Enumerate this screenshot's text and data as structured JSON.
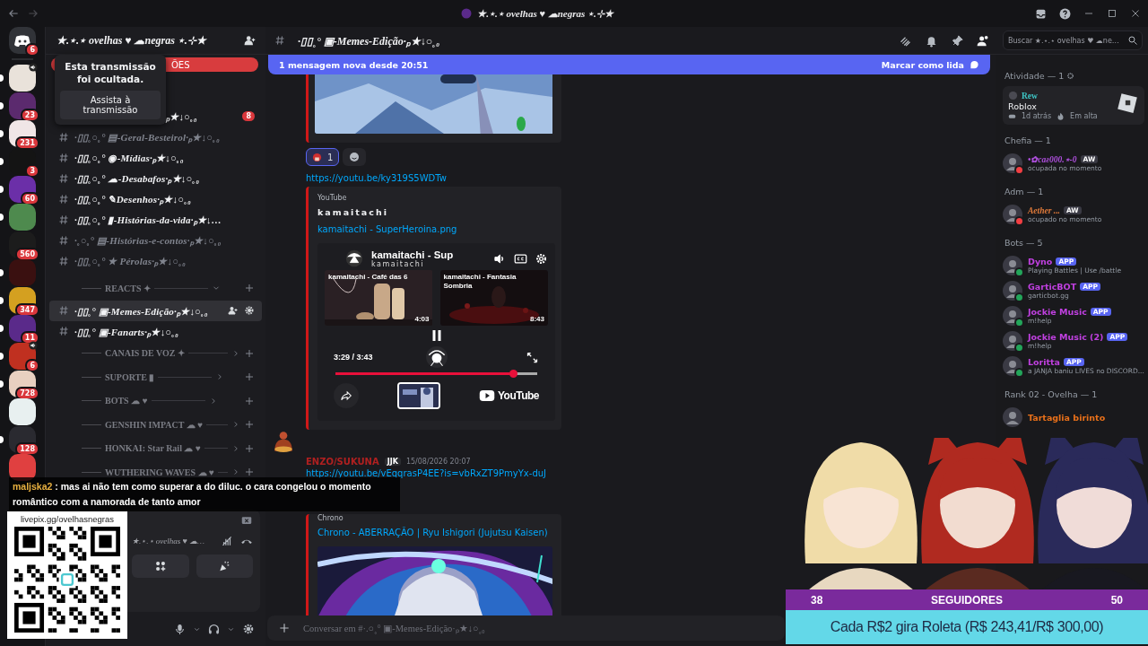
{
  "window": {
    "title": "★.⋆.⋆ ovelhas ♥ ☁negras ⋆.⊹★"
  },
  "servers": [
    {
      "badge": "6",
      "color": "#313338",
      "unread": false,
      "speaker": false,
      "kind": "home"
    },
    {
      "color": "#e9e2da",
      "unread": true,
      "speaker": true,
      "kind": "server"
    },
    {
      "badge": "23",
      "color": "#5b2a6e",
      "unread": true,
      "speaker": false,
      "kind": "server"
    },
    {
      "badge": "231",
      "color": "#f0e6e6",
      "unread": true,
      "speaker": false,
      "kind": "server"
    },
    {
      "badge": "3",
      "color": "#141414",
      "unread": true,
      "speaker": false,
      "kind": "server"
    },
    {
      "badge": "60",
      "color": "#6b2fa8",
      "unread": true,
      "speaker": false,
      "kind": "server"
    },
    {
      "color": "#4e8a4e",
      "unread": true,
      "speaker": false,
      "kind": "server"
    },
    {
      "badge": "560",
      "color": "#1c1c1c",
      "unread": false,
      "speaker": false,
      "kind": "server"
    },
    {
      "color": "#3a1010",
      "unread": true,
      "speaker": false,
      "kind": "server"
    },
    {
      "badge": "347",
      "color": "#d4a020",
      "unread": true,
      "speaker": false,
      "kind": "server"
    },
    {
      "badge": "11",
      "color": "#5a2a8a",
      "unread": true,
      "speaker": false,
      "kind": "server"
    },
    {
      "badge": "6",
      "color": "#c03020",
      "unread": true,
      "speaker": true,
      "kind": "server"
    },
    {
      "badge": "728",
      "color": "#e8d0c0",
      "unread": true,
      "speaker": false,
      "kind": "server"
    },
    {
      "color": "#e8f0f0",
      "unread": false,
      "speaker": false,
      "kind": "server"
    },
    {
      "badge": "128",
      "color": "#2a2a30",
      "unread": true,
      "speaker": false,
      "kind": "server"
    },
    {
      "color": "#e04040",
      "unread": false,
      "speaker": false,
      "kind": "server"
    }
  ],
  "sidebar": {
    "server_name": "★.⋆.⋆ ovelhas ♥ ☁negras ⋆.⊹★",
    "events_text": "ÕES",
    "tooltip": {
      "message": "Esta transmissão foi ocultada.",
      "button": "Assista à transmissão"
    },
    "partial_channel": {
      "text": "ₚ★↓○˳₀",
      "badge": "8"
    },
    "channels": [
      {
        "kind": "channel",
        "name": "·▯▯˳○˳° ▤-Geral-Besteirol·ₚ★↓○˳₀",
        "unread": false,
        "selected": false
      },
      {
        "kind": "channel",
        "name": "·▯▯˳○˳° ◉-Mídias·ₚ★↓○˳₀",
        "unread": true,
        "selected": false
      },
      {
        "kind": "channel",
        "name": "·▯▯˳○˳° ☁-Desabafos·ₚ★↓○˳₀",
        "unread": true,
        "selected": false
      },
      {
        "kind": "channel",
        "name": "·▯▯˳○˳° ✎Desenhos·ₚ★↓○˳₀",
        "unread": true,
        "selected": false
      },
      {
        "kind": "channel",
        "name": "·▯▯˳○˳° ▮-Histórias-da-vida·ₚ★↓…",
        "unread": true,
        "selected": false
      },
      {
        "kind": "channel",
        "name": "·˳○˳° ▤-Histórias-e-contos·ₚ★↓○˳₀",
        "unread": false,
        "selected": false
      },
      {
        "kind": "channel",
        "name": "·▯▯˳○˳° ★ Pérolas·ₚ★↓○˳₀",
        "unread": false,
        "selected": false
      },
      {
        "kind": "category",
        "name": "REACTS ✦",
        "expanded": true
      },
      {
        "kind": "channel",
        "name": "·▯▯˳° ▣-Memes-Edição·ₚ★↓○˳₀",
        "unread": true,
        "selected": true
      },
      {
        "kind": "channel",
        "name": "·▯▯˳° ▣-Fanarts·ₚ★↓○˳₀",
        "unread": true,
        "selected": false
      },
      {
        "kind": "category",
        "name": "CANAIS DE VOZ ✦",
        "expanded": false
      },
      {
        "kind": "category",
        "name": "SUPORTE ▮",
        "expanded": false
      },
      {
        "kind": "category",
        "name": "BOTS ☁ ♥",
        "expanded": false
      },
      {
        "kind": "category",
        "name": "GENSHIN IMPACT ☁ ♥",
        "expanded": false
      },
      {
        "kind": "category",
        "name": "HONKAI: Star Rail ☁ ♥",
        "expanded": false
      },
      {
        "kind": "category",
        "name": "WUTHERING WAVES ☁ ♥",
        "expanded": false
      }
    ],
    "voice_panel": {
      "server": "★.⋆.⋆ ovelhas ♥ ☁…"
    }
  },
  "chat": {
    "channel": "·▯▯˳° ▣-Memes-Edição·ₚ★↓○˳₀",
    "search": {
      "placeholder": "Buscar ★.⋆.⋆ ovelhas ♥ ☁ne…"
    },
    "new_messages": {
      "text": "1 mensagem nova desde 20:51",
      "action": "Marcar como lida"
    },
    "messages": [
      {
        "kind": "continuation",
        "reactions": [
          {
            "count": "1",
            "selected": true
          }
        ],
        "link": "https://youtu.be/ky319S5WDTw",
        "embed": {
          "provider": "YouTube",
          "author": "kamaitachi",
          "title": "kamaitachi - SuperHeroina.png",
          "player": {
            "title": "kamaitachi - Sup",
            "channel": "kamaitachi",
            "suggestions": [
              {
                "title": "kamaitachi - Café das 6",
                "duration": "4:03"
              },
              {
                "title": "kamaitachi - Fantasia Sombria",
                "duration": "8:43"
              }
            ],
            "time": "3:29 / 3:43",
            "level": 0.88,
            "logo": "YouTube"
          }
        }
      },
      {
        "kind": "message",
        "author": "ENZO/SUKUNA",
        "color": "#b02020",
        "tag": "JJK",
        "timestamp": "15/08/2026 20:07",
        "link": "https://youtu.be/vEqqrasP4EE?is=vbRxZT9PmyYx-duJ",
        "embed": {
          "provider": "Chrono",
          "title": "Chrono - ABERRAÇÃO | Ryu Ishigori (Jujutsu Kaisen)"
        }
      }
    ],
    "composer": {
      "placeholder": "Conversar em #·.○˳° ▣-Memes-Edição·ₚ★↓○˳₀"
    }
  },
  "members": {
    "activity": {
      "header": "Atividade — 1",
      "user": "Rew",
      "game": "Roblox",
      "time": "1d atrás",
      "trend": "Em alta"
    },
    "groups": [
      {
        "header": "Chefia — 1",
        "members": [
          {
            "name": "•✿caƨ000.⋆-0",
            "color": "#b050e0",
            "tag": "AW",
            "kind": "guild",
            "status": "ocupada no momento",
            "dnd": true
          }
        ]
      },
      {
        "header": "Adm — 1",
        "members": [
          {
            "name": "Aether ...",
            "color": "#e07a3a",
            "tag": "AW",
            "kind": "guild",
            "status": "ocupado no momento",
            "dnd": true
          }
        ]
      },
      {
        "header": "Bots — 5",
        "members": [
          {
            "name": "Dyno",
            "color": "#c040e0",
            "tag": "APP",
            "kind": "app",
            "status": "Playing Battles | Use /battle",
            "dnd": false
          },
          {
            "name": "GarticBOT",
            "color": "#c040e0",
            "tag": "APP",
            "kind": "app",
            "status": "garticbot.gg",
            "dnd": false
          },
          {
            "name": "Jockie Music",
            "color": "#c040e0",
            "tag": "APP",
            "kind": "app",
            "status": "m!help",
            "dnd": false
          },
          {
            "name": "Jockie Music (2)",
            "color": "#c040e0",
            "tag": "APP",
            "kind": "app",
            "status": "m!help",
            "dnd": false
          },
          {
            "name": "Loritta",
            "color": "#c040e0",
            "tag": "APP",
            "kind": "app",
            "status": "a JANJA baniu LIVES no DISCORD...",
            "dnd": false
          }
        ]
      },
      {
        "header": "Rank 02 - Ovelha — 1",
        "members": [
          {
            "name": "Tartaglia birinto",
            "color": "#e8701a",
            "kind": "plain"
          }
        ]
      }
    ]
  },
  "stream_overlay": {
    "chat": {
      "user": "maljska2",
      "text": " : mas ai não tem como superar a do diluc. o cara congelou o momento romântico com a namorada de tanto amor"
    },
    "qr_url": "livepix.gg/ovelhasnegras",
    "followers": {
      "current": "38",
      "label": "SEGUIDORES",
      "goal": "50"
    },
    "goal_text": "Cada R$2 gira Roleta (R$ 243,41/R$ 300,00)"
  }
}
